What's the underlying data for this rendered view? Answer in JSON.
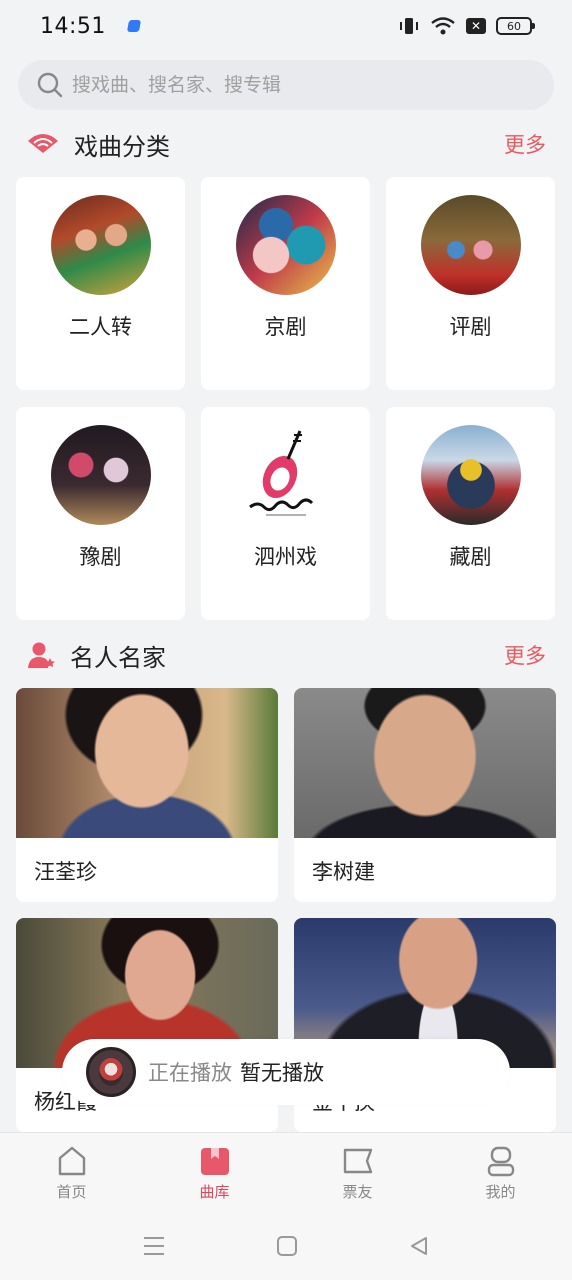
{
  "status": {
    "time": "14:51",
    "battery": "60"
  },
  "search": {
    "placeholder": "搜戏曲、搜名家、搜专辑"
  },
  "opera_section": {
    "title": "戏曲分类",
    "more": "更多",
    "items": [
      {
        "label": "二人转"
      },
      {
        "label": "京剧"
      },
      {
        "label": "评剧"
      },
      {
        "label": "豫剧"
      },
      {
        "label": "泗州戏"
      },
      {
        "label": "藏剧"
      }
    ]
  },
  "celeb_section": {
    "title": "名人名家",
    "more": "更多",
    "items": [
      {
        "name": "汪荃珍"
      },
      {
        "name": "李树建"
      },
      {
        "name": "杨红霞"
      },
      {
        "name": "金不换"
      }
    ]
  },
  "now_playing": {
    "label": "正在播放",
    "value": "暂无播放"
  },
  "tabs": [
    {
      "label": "首页",
      "icon": "home-icon"
    },
    {
      "label": "曲库",
      "icon": "library-icon",
      "active": true
    },
    {
      "label": "票友",
      "icon": "fans-icon"
    },
    {
      "label": "我的",
      "icon": "profile-icon"
    }
  ],
  "colors": {
    "accent": "#e0455a",
    "more": "#e85a62",
    "background": "#f2f3f5"
  }
}
